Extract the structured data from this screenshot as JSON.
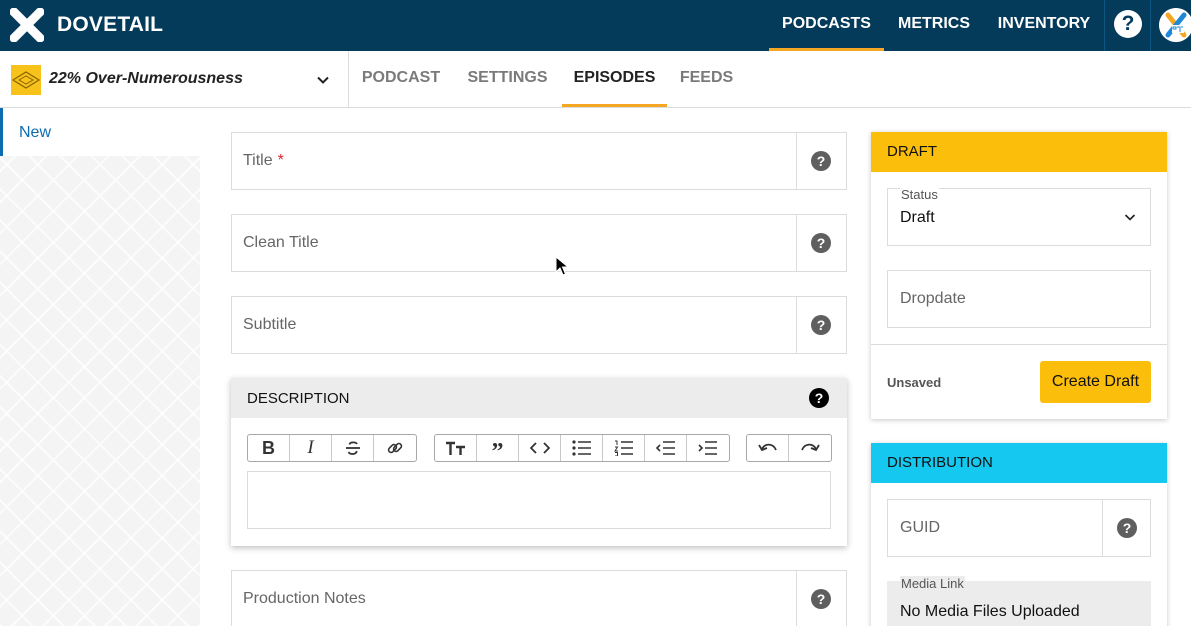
{
  "app": {
    "brand": "DOVETAIL"
  },
  "topnav": {
    "items": [
      "PODCASTS",
      "METRICS",
      "INVENTORY"
    ],
    "active": "PODCASTS",
    "help": "?"
  },
  "podcast": {
    "name": "22% Over-Numerousness"
  },
  "subnav": {
    "tabs": [
      "PODCAST",
      "SETTINGS",
      "EPISODES",
      "FEEDS"
    ],
    "active": "EPISODES"
  },
  "sidebar": {
    "new_label": "New"
  },
  "form": {
    "title_label": "Title",
    "required_mark": "*",
    "clean_title_label": "Clean Title",
    "subtitle_label": "Subtitle",
    "production_notes_label": "Production Notes",
    "help_glyph": "?"
  },
  "description": {
    "title": "DESCRIPTION",
    "toolbar": {
      "group1": [
        "bold-icon",
        "italic-icon",
        "strikethrough-icon",
        "link-icon"
      ],
      "group2": [
        "text-size-icon",
        "quote-icon",
        "code-icon",
        "bullet-list-icon",
        "numbered-list-icon",
        "outdent-icon",
        "indent-icon"
      ],
      "group3": [
        "undo-icon",
        "redo-icon"
      ]
    }
  },
  "draft_panel": {
    "header": "DRAFT",
    "status_label": "Status",
    "status_value": "Draft",
    "dropdate_placeholder": "Dropdate",
    "unsaved": "Unsaved",
    "create_button": "Create Draft"
  },
  "distribution_panel": {
    "header": "DISTRIBUTION",
    "guid_label": "GUID",
    "media_link_label": "Media Link",
    "media_link_value": "No Media Files Uploaded"
  },
  "colors": {
    "topbar": "#043a5a",
    "accent_orange": "#f5a623",
    "draft_yellow": "#fbbf0b",
    "distribution_cyan": "#14c8ef",
    "link_blue": "#0d6cae"
  }
}
